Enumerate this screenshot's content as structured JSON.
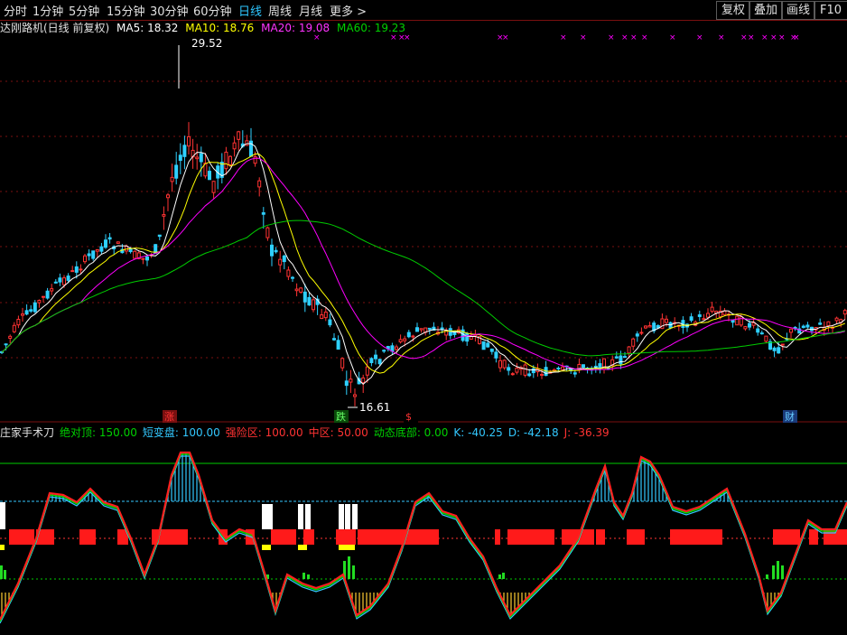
{
  "toolbar": {
    "periods": [
      "分时",
      "1分钟",
      "5分钟",
      "15分钟",
      "30分钟",
      "60分钟",
      "日线",
      "周线",
      "月线",
      "更多 >"
    ],
    "active_period": "日线",
    "buttons": [
      "复权",
      "叠加",
      "画线",
      "F10"
    ]
  },
  "main_chart": {
    "stock_label": "达刚路机(日线 前复权)",
    "ma5": "MA5: 18.32",
    "ma10": "MA10: 18.76",
    "ma20": "MA20: 19.08",
    "ma60": "MA60: 19.23",
    "high_marker": "29.52",
    "low_marker": "16.61",
    "events": [
      {
        "label": "涨",
        "type": "up"
      },
      {
        "label": "跌",
        "type": "down"
      },
      {
        "label": "$",
        "type": "dollar"
      },
      {
        "label": "财",
        "type": "finance"
      }
    ],
    "colors": {
      "ma5": "#ffffff",
      "ma10": "#ffff00",
      "ma20": "#ff00ff",
      "ma60": "#00cc00",
      "up": "#ff3333",
      "down": "#2ed0ff"
    }
  },
  "indicator": {
    "name": "庄家手术刀",
    "items": [
      {
        "text": "绝对顶: 150.00",
        "color": "#00d000"
      },
      {
        "text": "短变盘: 100.00",
        "color": "#33c8ff"
      },
      {
        "text": "强险区: 100.00",
        "color": "#ff3333"
      },
      {
        "text": "中区: 50.00",
        "color": "#ff3333"
      },
      {
        "text": "动态底部: 0.00",
        "color": "#00d000"
      },
      {
        "text": "K: -40.25",
        "color": "#33c8ff"
      },
      {
        "text": "D: -42.18",
        "color": "#33c8ff"
      },
      {
        "text": "J: -36.39",
        "color": "#ff3333"
      }
    ]
  }
}
